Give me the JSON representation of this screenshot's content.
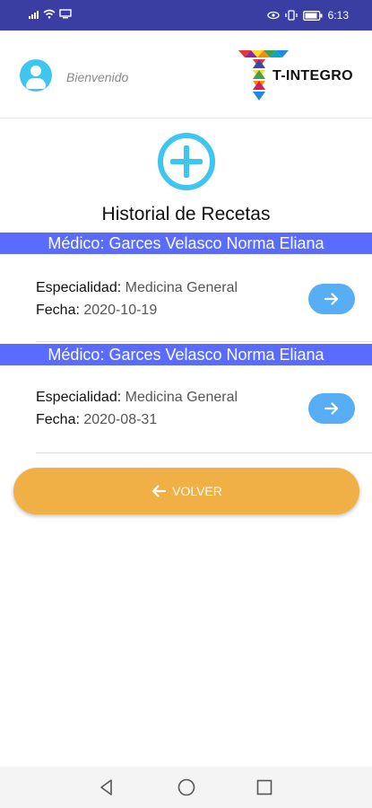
{
  "status_bar": {
    "time": "6:13"
  },
  "header": {
    "welcome": "Bienvenido",
    "brand_name": "T-INTEGRO"
  },
  "page": {
    "title": "Historial de Recetas"
  },
  "records": [
    {
      "doctor": "Médico: Garces Velasco Norma Eliana",
      "specialty_label": "Especialidad:",
      "specialty": "Medicina General",
      "date_label": "Fecha:",
      "date": "2020-10-19"
    },
    {
      "doctor": "Médico: Garces Velasco Norma Eliana",
      "specialty_label": "Especialidad:",
      "specialty": "Medicina General",
      "date_label": "Fecha:",
      "date": "2020-08-31"
    }
  ],
  "actions": {
    "back_label": "VOLVER"
  },
  "colors": {
    "status_bar": "#3a3ea3",
    "accent_cyan": "#3fc6ee",
    "record_header": "#5a6cff",
    "go_button": "#57aef5",
    "back_button": "#f1b045"
  },
  "icons": [
    "signal-icon",
    "wifi-icon",
    "cast-icon",
    "eye-icon",
    "vibrate-icon",
    "battery-icon",
    "user-avatar-icon",
    "brand-logo-icon",
    "add-circle-icon",
    "arrow-right-icon",
    "arrow-left-icon",
    "nav-back-icon",
    "nav-home-icon",
    "nav-recents-icon"
  ]
}
